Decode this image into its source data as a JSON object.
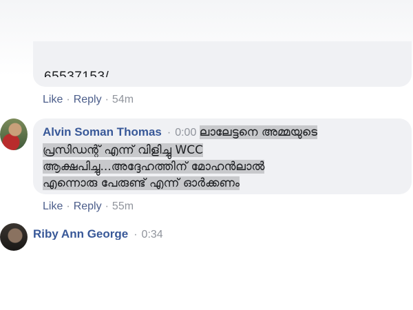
{
  "comments": [
    {
      "partial_text": "65537153/",
      "actions": {
        "like": "Like",
        "reply": "Reply",
        "time": "54m"
      }
    },
    {
      "author": "Alvin Soman Thomas",
      "timestamp": "0:00",
      "lines": [
        "ലാലേട്ടനെ അമ്മയുടെ",
        "പ്രസിഡന്റ് എന്ന് വിളിച്ചു WCC",
        "ആക്ഷപിച്ചു...അദ്ദേഹത്തിന് മോഹൻലാൽ",
        "എന്നൊരു പേരുണ്ട് എന്ന് ഓർക്കണം"
      ],
      "actions": {
        "like": "Like",
        "reply": "Reply",
        "time": "55m"
      }
    },
    {
      "author": "Riby Ann George",
      "timestamp": "0:34"
    }
  ],
  "separator": "·"
}
